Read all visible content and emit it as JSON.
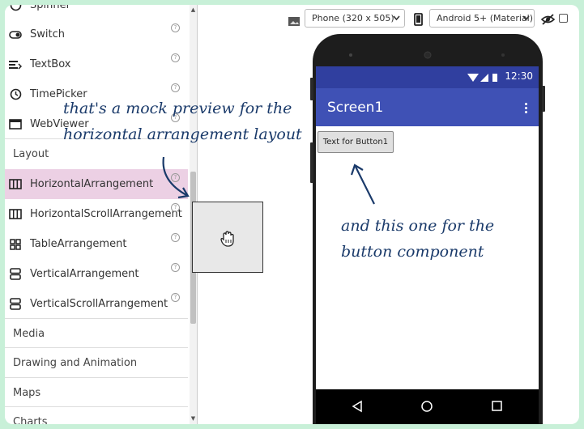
{
  "palette": {
    "items": [
      {
        "label": "Spinner",
        "icon": "spinner-icon",
        "help": "?"
      },
      {
        "label": "Switch",
        "icon": "switch-icon",
        "help": "?"
      },
      {
        "label": "TextBox",
        "icon": "textbox-icon",
        "help": "?"
      },
      {
        "label": "TimePicker",
        "icon": "clock-icon",
        "help": "?"
      },
      {
        "label": "WebViewer",
        "icon": "webviewer-icon",
        "help": "?"
      }
    ],
    "category_layout": "Layout",
    "layout_items": [
      {
        "label": "HorizontalArrangement",
        "icon": "horizontal-arrangement-icon",
        "help": "?",
        "selected": true
      },
      {
        "label": "HorizontalScrollArrangement",
        "icon": "horizontal-scroll-arrangement-icon",
        "help": "?"
      },
      {
        "label": "TableArrangement",
        "icon": "table-arrangement-icon",
        "help": "?"
      },
      {
        "label": "VerticalArrangement",
        "icon": "vertical-arrangement-icon",
        "help": "?"
      },
      {
        "label": "VerticalScrollArrangement",
        "icon": "vertical-scroll-arrangement-icon",
        "help": "?"
      }
    ],
    "categories": [
      "Media",
      "Drawing and Animation",
      "Maps",
      "Charts"
    ]
  },
  "toolbar": {
    "phone_size": "Phone (320 x 505)",
    "theme": "Android 5+ (Material)"
  },
  "phone": {
    "time": "12:30",
    "screen_title": "Screen1",
    "button_text": "Text for Button1"
  },
  "annotations": {
    "left_line1": "that's a mock preview for the",
    "left_line2": "horizontal arrangement layout",
    "right_line1": "and this one for the",
    "right_line2": "button component"
  },
  "colors": {
    "status_bar": "#303f9f",
    "app_bar": "#3f51b5",
    "selected_item": "#ecd0e4",
    "annotation": "#1a3a6a",
    "background": "#c8f0d8"
  }
}
